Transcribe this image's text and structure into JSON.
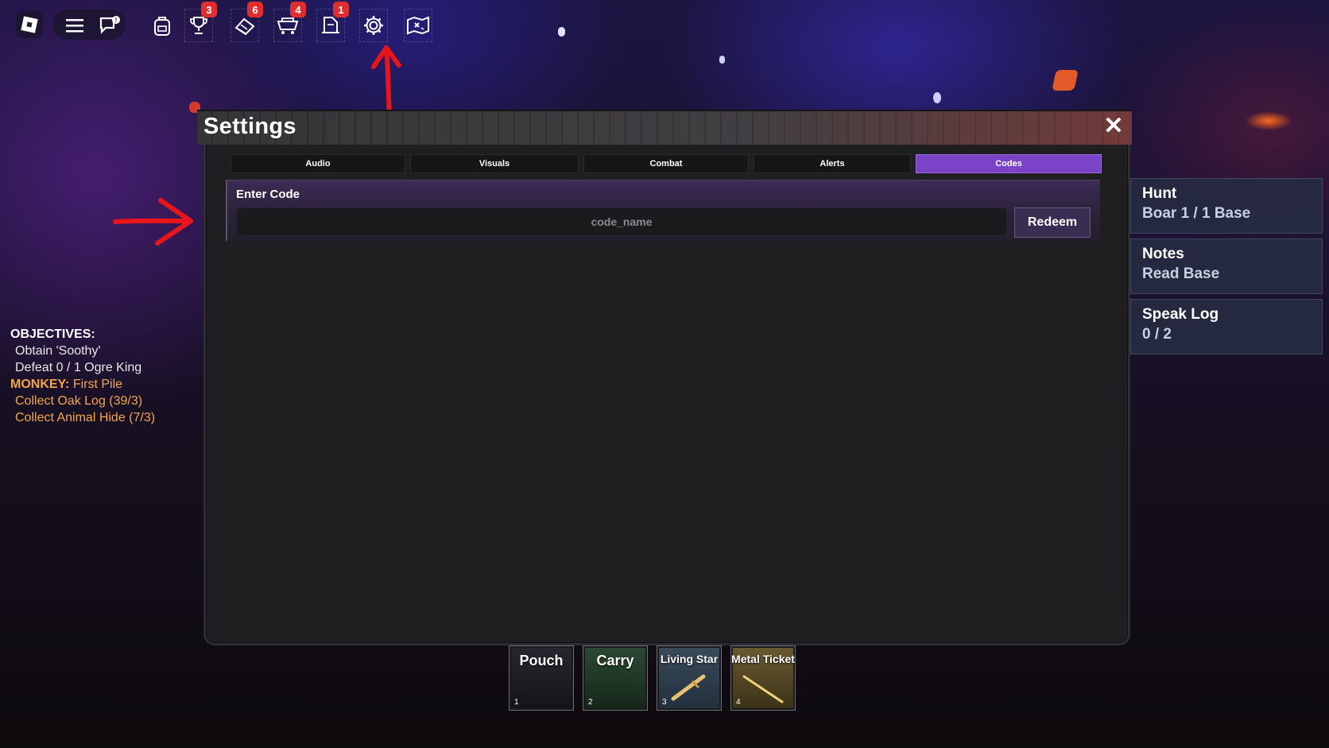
{
  "topbar": {
    "badges": {
      "trophy": "3",
      "scrolls": "6",
      "cart": "4",
      "shop": "1"
    }
  },
  "settings": {
    "title": "Settings",
    "close": "✕",
    "tabs": [
      {
        "label": "Audio"
      },
      {
        "label": "Visuals"
      },
      {
        "label": "Combat"
      },
      {
        "label": "Alerts"
      },
      {
        "label": "Codes"
      }
    ],
    "active_tab": "Codes",
    "code": {
      "label": "Enter Code",
      "placeholder": "code_name",
      "value": "",
      "button": "Redeem"
    }
  },
  "objectives": {
    "header": "OBJECTIVES:",
    "items": [
      "Obtain 'Soothy'",
      "Defeat 0 / 1 Ogre King"
    ],
    "monkey_label": "MONKEY:",
    "monkey_task": " First Pile",
    "monkey_items": [
      "Collect Oak Log (39/3)",
      "Collect Animal Hide (7/3)"
    ]
  },
  "quests": [
    {
      "title": "Hunt",
      "detail": "Boar 1 / 1 Base"
    },
    {
      "title": "Notes",
      "detail": "Read Base"
    },
    {
      "title": "Speak Log",
      "detail": "0 / 2"
    }
  ],
  "hotbar": [
    {
      "label": "Pouch",
      "slot": "1"
    },
    {
      "label": "Carry",
      "slot": "2"
    },
    {
      "label": "Living Star",
      "slot": "3"
    },
    {
      "label": "Metal Ticket",
      "slot": "4"
    }
  ],
  "colors": {
    "accent": "#7a43c8",
    "badge": "#e02d2d",
    "objective_orange": "#f3a64a",
    "annotation_red": "#e8161a"
  }
}
